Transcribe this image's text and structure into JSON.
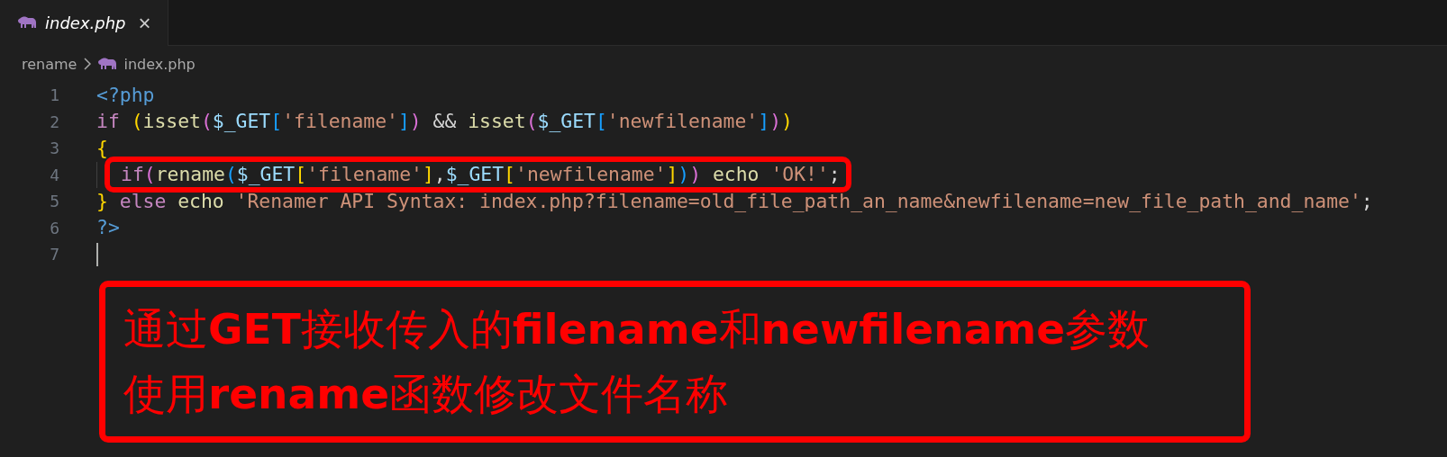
{
  "tabs": [
    {
      "label": "index.php",
      "selected": true,
      "close": "×"
    }
  ],
  "breadcrumb": [
    {
      "label": "rename",
      "icon": false
    },
    {
      "label": "index.php",
      "icon": true
    }
  ],
  "code": [
    {
      "number": "1",
      "highlighted": false,
      "tokens": [
        {
          "kind": "tag",
          "text": "<?php"
        }
      ]
    },
    {
      "number": "2",
      "highlighted": false,
      "tokens": [
        {
          "kind": "kw",
          "text": "if "
        },
        {
          "kind": "br1",
          "text": "("
        },
        {
          "kind": "fn",
          "text": "isset"
        },
        {
          "kind": "br2",
          "text": "("
        },
        {
          "kind": "var",
          "text": "$_GET"
        },
        {
          "kind": "br3",
          "text": "["
        },
        {
          "kind": "str",
          "text": "'filename'"
        },
        {
          "kind": "br3",
          "text": "]"
        },
        {
          "kind": "br2",
          "text": ")"
        },
        {
          "kind": "punc",
          "text": " && "
        },
        {
          "kind": "fn",
          "text": "isset"
        },
        {
          "kind": "br2",
          "text": "("
        },
        {
          "kind": "var",
          "text": "$_GET"
        },
        {
          "kind": "br3",
          "text": "["
        },
        {
          "kind": "str",
          "text": "'newfilename'"
        },
        {
          "kind": "br3",
          "text": "]"
        },
        {
          "kind": "br2",
          "text": ")"
        },
        {
          "kind": "br1",
          "text": ")"
        }
      ]
    },
    {
      "number": "3",
      "highlighted": false,
      "tokens": [
        {
          "kind": "br1",
          "text": "{"
        }
      ]
    },
    {
      "number": "4",
      "highlighted": true,
      "tokens": [
        {
          "kind": "kw",
          "text": "if"
        },
        {
          "kind": "br2",
          "text": "("
        },
        {
          "kind": "fn",
          "text": "rename"
        },
        {
          "kind": "br3",
          "text": "("
        },
        {
          "kind": "var",
          "text": "$_GET"
        },
        {
          "kind": "br1",
          "text": "["
        },
        {
          "kind": "str",
          "text": "'filename'"
        },
        {
          "kind": "br1",
          "text": "]"
        },
        {
          "kind": "punc",
          "text": ","
        },
        {
          "kind": "var",
          "text": "$_GET"
        },
        {
          "kind": "br1",
          "text": "["
        },
        {
          "kind": "str",
          "text": "'newfilename'"
        },
        {
          "kind": "br1",
          "text": "]"
        },
        {
          "kind": "br3",
          "text": ")"
        },
        {
          "kind": "br2",
          "text": ")"
        },
        {
          "kind": "fn",
          "text": " echo "
        },
        {
          "kind": "str",
          "text": "'OK!'"
        },
        {
          "kind": "punc",
          "text": ";"
        }
      ]
    },
    {
      "number": "5",
      "highlighted": false,
      "tokens": [
        {
          "kind": "br1",
          "text": "}"
        },
        {
          "kind": "kw",
          "text": " else "
        },
        {
          "kind": "fn",
          "text": "echo "
        },
        {
          "kind": "str",
          "text": "'Renamer API Syntax: index.php?filename=old_file_path_an_name&newfilename=new_file_path_and_name'"
        },
        {
          "kind": "punc",
          "text": ";"
        }
      ]
    },
    {
      "number": "6",
      "highlighted": false,
      "tokens": [
        {
          "kind": "tag",
          "text": "?>"
        }
      ]
    },
    {
      "number": "7",
      "highlighted": false
    }
  ],
  "annotation": {
    "lines": [
      "通过**GET**接收传入的**filename**和**newfilename**参数",
      "使用**rename**函数修改文件名称"
    ]
  }
}
